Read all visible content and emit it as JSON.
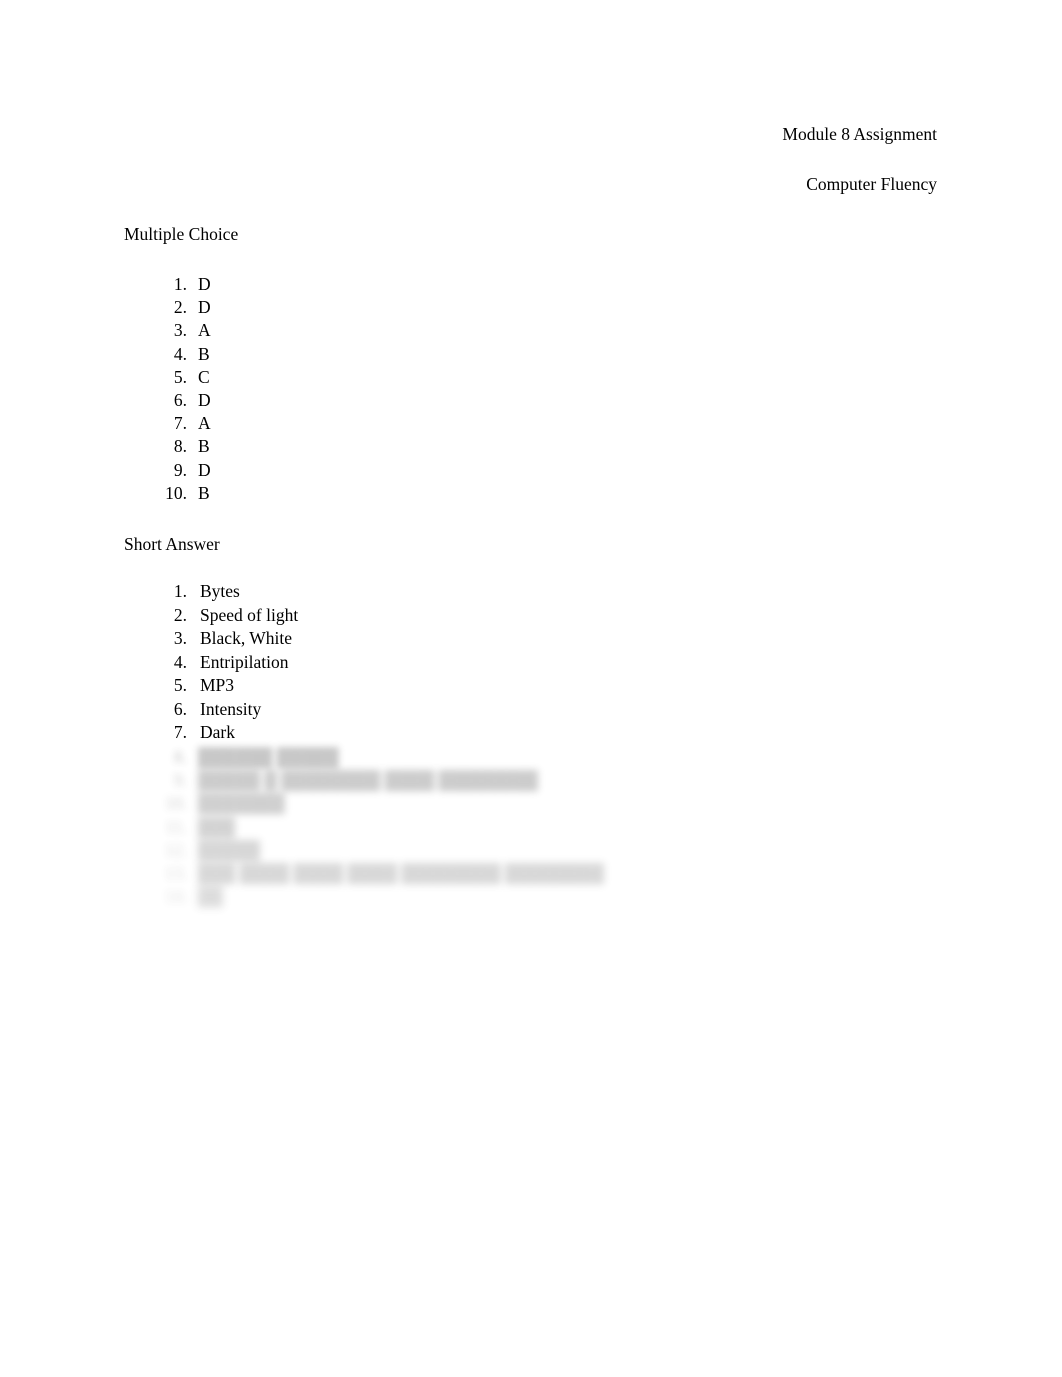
{
  "document": {
    "background_color": "#ffffff",
    "text_color": "#000000",
    "header": {
      "line1": "Module 8 Assignment",
      "line2": "Computer Fluency"
    },
    "sections": {
      "multiple_choice": {
        "heading": "Multiple Choice",
        "items": [
          {
            "number": "1.",
            "answer": "D"
          },
          {
            "number": "2.",
            "answer": "D"
          },
          {
            "number": "3.",
            "answer": "A"
          },
          {
            "number": "4.",
            "answer": "B"
          },
          {
            "number": "5.",
            "answer": "C"
          },
          {
            "number": "6.",
            "answer": "D"
          },
          {
            "number": "7.",
            "answer": "A"
          },
          {
            "number": "8.",
            "answer": "B"
          },
          {
            "number": "9.",
            "answer": "D"
          },
          {
            "number": "10.",
            "answer": "B"
          }
        ]
      },
      "short_answer": {
        "heading": "Short Answer",
        "items": [
          {
            "number": "1.",
            "answer": "Bytes"
          },
          {
            "number": "2.",
            "answer": "Speed of light"
          },
          {
            "number": "3.",
            "answer": "Black, White"
          },
          {
            "number": "4.",
            "answer": "Entripilation"
          },
          {
            "number": "5.",
            "answer": "MP3"
          },
          {
            "number": "6.",
            "answer": "Intensity"
          },
          {
            "number": "7.",
            "answer": "Dark"
          }
        ],
        "obscured_items": [
          {
            "number": "8.",
            "answer": "██████ █████"
          },
          {
            "number": "9.",
            "answer": "█████ █ ████████ ████ ████████"
          },
          {
            "number": "10.",
            "answer": "███████"
          },
          {
            "number": "11.",
            "answer": "███"
          },
          {
            "number": "12.",
            "answer": "█████"
          },
          {
            "number": "13.",
            "answer": "███ ████ ████ ████ ████████ ████████"
          },
          {
            "number": "14.",
            "answer": "██"
          }
        ]
      }
    }
  }
}
